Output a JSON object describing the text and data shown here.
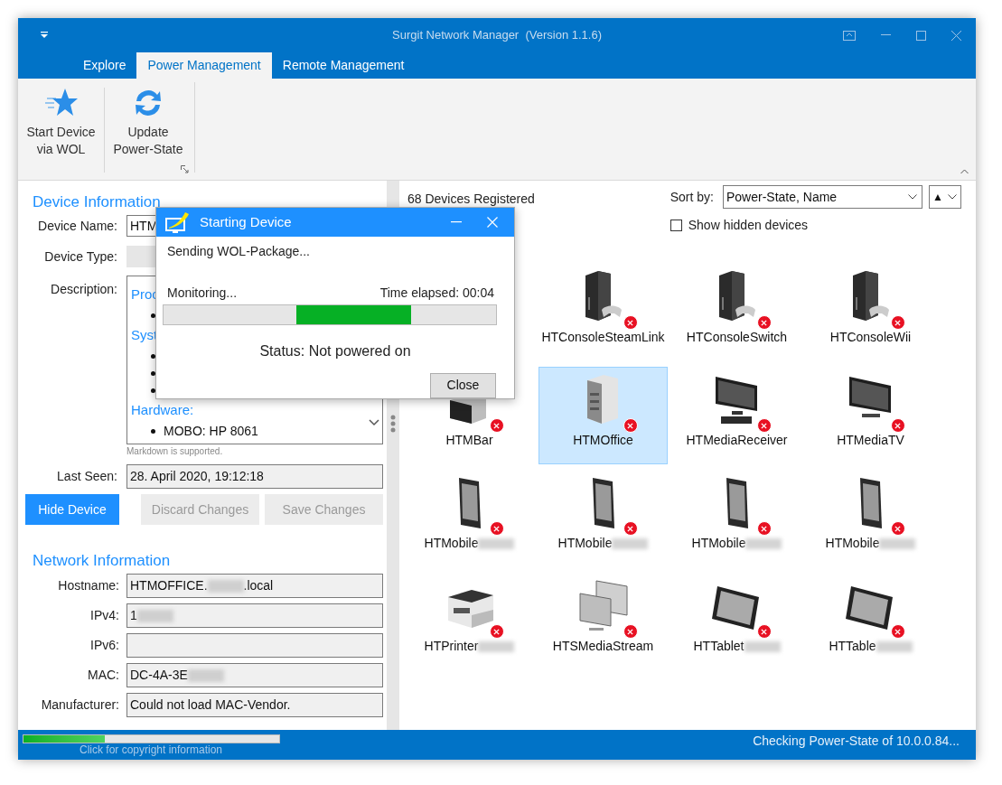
{
  "window": {
    "title": "Surgit Network Manager  (Version 1.1.6)"
  },
  "tabs": [
    {
      "label": "Explore",
      "selected": false
    },
    {
      "label": "Power Management",
      "selected": true
    },
    {
      "label": "Remote Management",
      "selected": false
    }
  ],
  "ribbon": {
    "buttons": [
      {
        "kind": "star",
        "label": "Start Device\nvia WOL"
      },
      {
        "kind": "refresh",
        "label": "Update\nPower-State"
      }
    ]
  },
  "device_information": {
    "heading": "Device Information",
    "fields": [
      {
        "label": "Device Name:",
        "value": "HTM",
        "kind": "edit"
      },
      {
        "label": "Device Type:",
        "kind": "readonly"
      }
    ],
    "description": {
      "label": "Description:",
      "lines": [
        {
          "kind": "heading",
          "text": "Proc"
        },
        {
          "kind": "bullet"
        },
        {
          "kind": "heading",
          "text": "Syst"
        },
        {
          "kind": "bullet"
        },
        {
          "kind": "bullet"
        },
        {
          "kind": "bullet"
        },
        {
          "kind": "heading",
          "text": "Hardware:"
        },
        {
          "kind": "bullet",
          "text": "MOBO: HP 8061"
        }
      ],
      "hint": "Markdown is supported."
    },
    "last_seen": {
      "label": "Last Seen:",
      "value": "28. April 2020, 19:12:18"
    },
    "buttons": [
      {
        "label": "Hide Device",
        "disabled": false
      },
      {
        "label": "Discard Changes",
        "disabled": true
      },
      {
        "label": "Save Changes",
        "disabled": true
      }
    ]
  },
  "network_information": {
    "heading": "Network Information",
    "fields": [
      {
        "label": "Hostname:",
        "value": "HTMOFFICE.",
        "redacted": true,
        "value_after": ".local"
      },
      {
        "label": "IPv4:",
        "value": "1",
        "redacted": true
      },
      {
        "label": "IPv6:"
      },
      {
        "label": "MAC:",
        "value": "DC-4A-3E",
        "redacted": true
      },
      {
        "label": "Manufacturer:",
        "value": "Could not load MAC-Vendor."
      }
    ]
  },
  "devices_panel": {
    "count": "68 Devices Registered",
    "sort_label": "Sort by:",
    "sort_value": "Power-State, Name",
    "order": "▲",
    "show_hidden": {
      "label": "Show hidden devices",
      "checked": false
    },
    "devices": [
      {
        "kind": "hidden"
      },
      {
        "name": "HTConsoleSteamLink",
        "kind": "console",
        "powered": false,
        "selected": false
      },
      {
        "name": "HTConsoleSwitch",
        "kind": "console",
        "powered": false,
        "selected": false
      },
      {
        "name": "HTConsoleWii",
        "kind": "console",
        "powered": false,
        "selected": false
      },
      {
        "name": "HTMBar",
        "kind": "desktop",
        "powered": false,
        "selected": false
      },
      {
        "name": "HTMOffice",
        "kind": "tower",
        "powered": false,
        "selected": true
      },
      {
        "name": "HTMediaReceiver",
        "kind": "receiver",
        "powered": false,
        "selected": false
      },
      {
        "name": "HTMediaTV",
        "kind": "tv",
        "powered": false,
        "selected": false
      },
      {
        "name": "HTMobile",
        "kind": "mobile",
        "powered": false,
        "selected": false,
        "redacted": true
      },
      {
        "name": "HTMobile",
        "kind": "mobile",
        "powered": false,
        "selected": false,
        "redacted": true
      },
      {
        "name": "HTMobile",
        "kind": "mobile",
        "powered": false,
        "selected": false,
        "redacted": true
      },
      {
        "name": "HTMobile",
        "kind": "mobile",
        "powered": false,
        "selected": false,
        "redacted": true
      },
      {
        "name": "HTPrinter",
        "kind": "printer",
        "powered": false,
        "selected": false,
        "redacted": true
      },
      {
        "name": "HTSMediaStream",
        "kind": "stream",
        "powered": false,
        "selected": false
      },
      {
        "name": "HTTablet",
        "kind": "tablet",
        "powered": false,
        "selected": false,
        "redacted": true
      },
      {
        "name": "HTTable",
        "kind": "tablet",
        "powered": false,
        "selected": false,
        "redacted": true
      }
    ]
  },
  "dialog": {
    "title": "Starting Device",
    "step": "Sending WOL-Package...",
    "activity": "Monitoring...",
    "elapsed": "Time elapsed: 00:04",
    "status": "Status: Not powered on",
    "button": "Close"
  },
  "status_bar": {
    "progress": {
      "level": 0.32
    },
    "copyright": "Click for copyright information",
    "message": "Checking Power-State of 10.0.0.84..."
  }
}
